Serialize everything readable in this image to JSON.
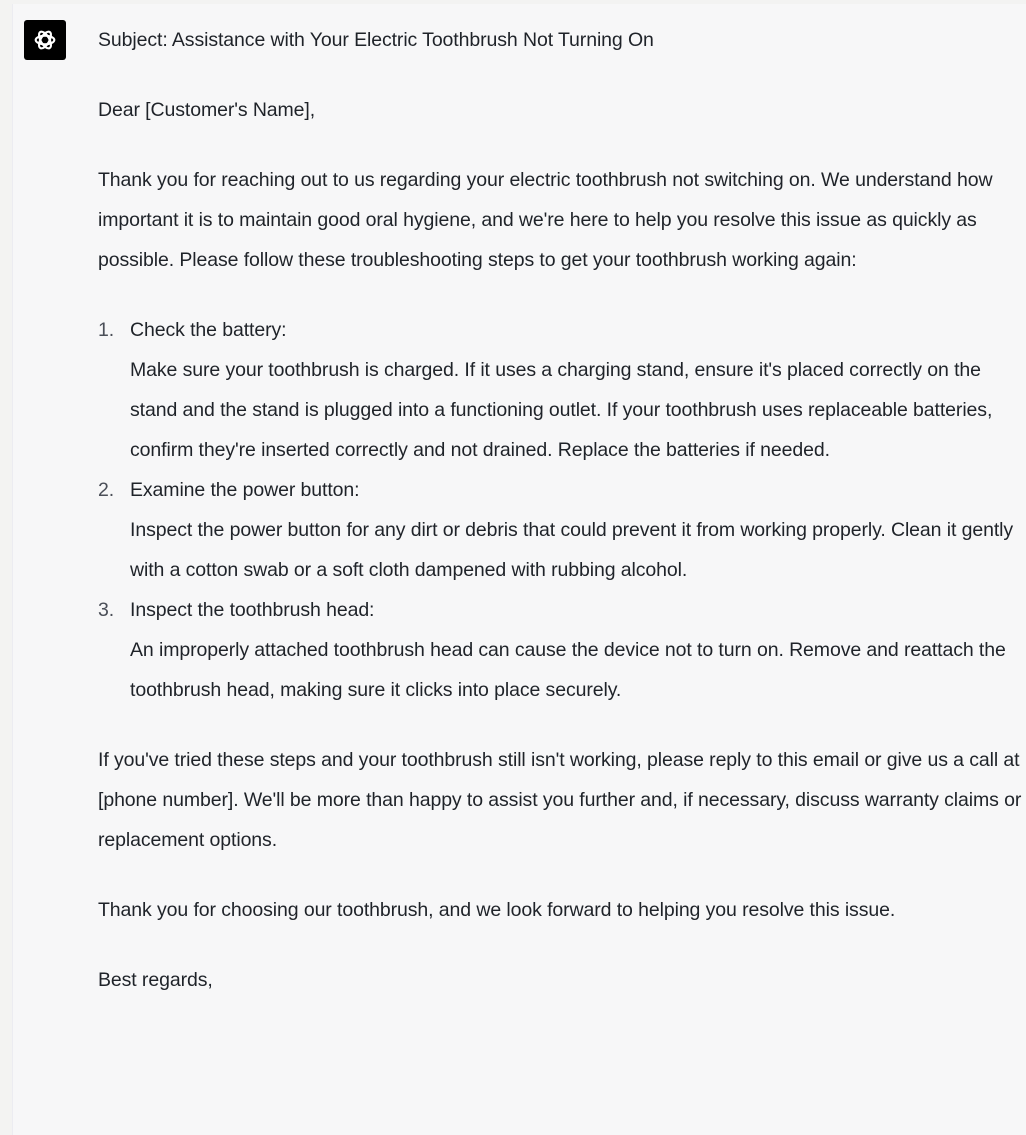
{
  "assistant": {
    "icon": "openai-logo-icon",
    "colors": {
      "avatar_bg": "#000000",
      "panel_bg": "#f7f7f8",
      "text": "#1f2329"
    }
  },
  "email": {
    "subject": "Subject: Assistance with Your Electric Toothbrush Not Turning On",
    "salutation": "Dear [Customer's Name],",
    "intro": "Thank you for reaching out to us regarding your electric toothbrush not switching on. We understand how important it is to maintain good oral hygiene, and we're here to help you resolve this issue as quickly as possible. Please follow these troubleshooting steps to get your toothbrush working again:",
    "steps": [
      {
        "number": "1.",
        "title": "Check the battery:",
        "text": "Make sure your toothbrush is charged. If it uses a charging stand, ensure it's placed correctly on the stand and the stand is plugged into a functioning outlet. If your toothbrush uses replaceable batteries, confirm they're inserted correctly and not drained. Replace the batteries if needed."
      },
      {
        "number": "2.",
        "title": "Examine the power button:",
        "text": "Inspect the power button for any dirt or debris that could prevent it from working properly. Clean it gently with a cotton swab or a soft cloth dampened with rubbing alcohol."
      },
      {
        "number": "3.",
        "title": "Inspect the toothbrush head:",
        "text": "An improperly attached toothbrush head can cause the device not to turn on. Remove and reattach the toothbrush head, making sure it clicks into place securely."
      }
    ],
    "closing": "If you've tried these steps and your toothbrush still isn't working, please reply to this email or give us a call at [phone number]. We'll be more than happy to assist you further and, if necessary, discuss warranty claims or replacement options.",
    "thanks": "Thank you for choosing our toothbrush, and we look forward to helping you resolve this issue.",
    "signoff": "Best regards,"
  }
}
